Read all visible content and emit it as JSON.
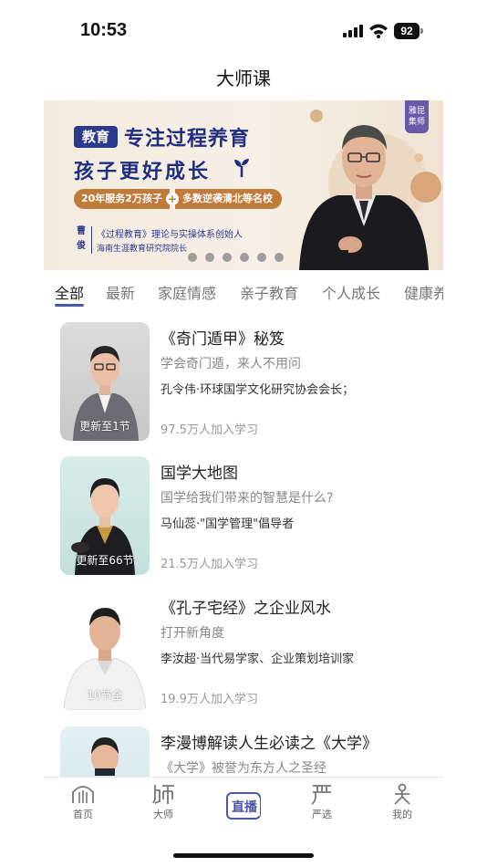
{
  "status_bar": {
    "time": "10:53",
    "battery": "92"
  },
  "page": {
    "title": "大师课"
  },
  "banner": {
    "tag": "教育",
    "headline_1": "专注过程养育",
    "headline_2": "孩子更好成长",
    "pill_a": "20年服务2万孩子",
    "pill_plus": "+",
    "pill_b": "多数逆袭清北等名校",
    "person_name": "曹俊",
    "person_role_1": "《过程教育》理论与实操体系创始人",
    "person_role_2": "海南生涯教育研究院院长",
    "badge": "雅昆集师"
  },
  "tabs": [
    {
      "label": "全部",
      "active": true
    },
    {
      "label": "最新"
    },
    {
      "label": "家庭情感"
    },
    {
      "label": "亲子教育"
    },
    {
      "label": "个人成长"
    },
    {
      "label": "健康养"
    }
  ],
  "courses": [
    {
      "title": "《奇门遁甲》秘笈",
      "subtitle": "学会奇门遁，来人不用问",
      "author": "孔令伟·环球国学文化研究协会会长；",
      "learners": "97.5万人加入学习",
      "thumb_caption": "更新至1节"
    },
    {
      "title": "国学大地图",
      "subtitle": "国学给我们带来的智慧是什么?",
      "author": "马仙蕊·\"国学管理\"倡导者",
      "learners": "21.5万人加入学习",
      "thumb_caption": "更新至66节"
    },
    {
      "title": "《孔子宅经》之企业风水",
      "subtitle": "打开新角度",
      "author": "李汝超·当代易学家、企业策划培训家",
      "learners": "19.9万人加入学习",
      "thumb_caption": "10节全"
    },
    {
      "title": "李漫博解读人生必读之《大学》",
      "subtitle": "《大学》被誉为东方人之圣经",
      "author": "",
      "learners": "",
      "thumb_caption": ""
    }
  ],
  "bottom_nav": {
    "home": "首页",
    "master": "大师",
    "live": "直播",
    "select": "严选",
    "mine": "我的"
  }
}
